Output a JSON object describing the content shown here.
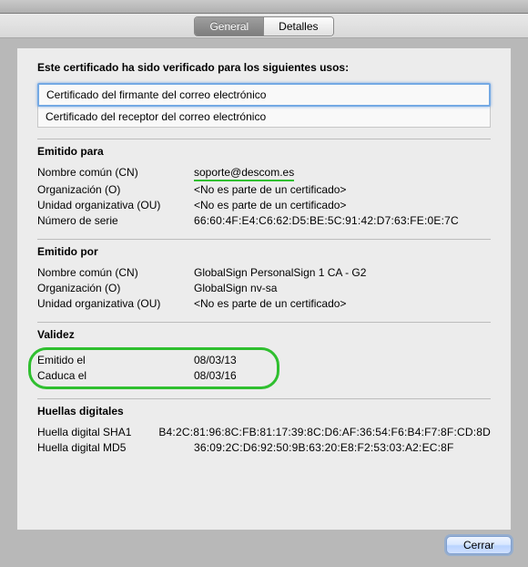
{
  "tabs": {
    "general": "General",
    "details": "Detalles"
  },
  "verified_heading": "Este certificado ha sido verificado para los siguientes usos:",
  "usages": {
    "signer": "Certificado del firmante del correo electrónico",
    "receiver": "Certificado del receptor del correo electrónico"
  },
  "issued_to": {
    "title": "Emitido para",
    "cn_label": "Nombre común (CN)",
    "cn_value": "soporte@descom.es",
    "o_label": "Organización (O)",
    "o_value": "<No es parte de un certificado>",
    "ou_label": "Unidad organizativa (OU)",
    "ou_value": "<No es parte de un certificado>",
    "serial_label": "Número de serie",
    "serial_value": "66:60:4F:E4:C6:62:D5:BE:5C:91:42:D7:63:FE:0E:7C"
  },
  "issued_by": {
    "title": "Emitido por",
    "cn_label": "Nombre común (CN)",
    "cn_value": "GlobalSign PersonalSign 1 CA - G2",
    "o_label": "Organización (O)",
    "o_value": "GlobalSign nv-sa",
    "ou_label": "Unidad organizativa (OU)",
    "ou_value": "<No es parte de un certificado>"
  },
  "validity": {
    "title": "Validez",
    "issued_label": "Emitido el",
    "issued_value": "08/03/13",
    "expires_label": "Caduca el",
    "expires_value": "08/03/16"
  },
  "fingerprints": {
    "title": "Huellas digitales",
    "sha1_label": "Huella digital SHA1",
    "sha1_value": "B4:2C:81:96:8C:FB:81:17:39:8C:D6:AF:36:54:F6:B4:F7:8F:CD:8D",
    "md5_label": "Huella digital MD5",
    "md5_value": "36:09:2C:D6:92:50:9B:63:20:E8:F2:53:03:A2:EC:8F"
  },
  "close_label": "Cerrar"
}
